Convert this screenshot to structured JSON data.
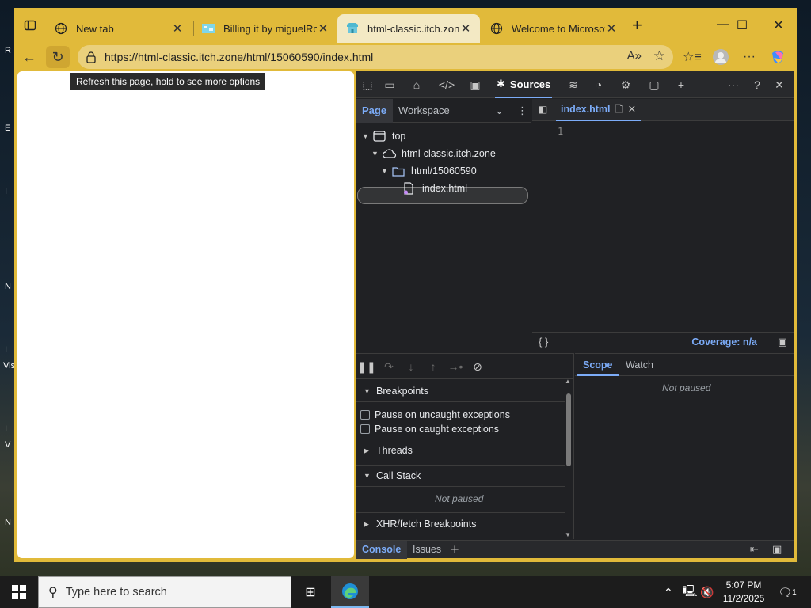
{
  "desktop": {
    "edge_letters": [
      "R",
      "E",
      "I",
      "N",
      "I",
      "Vis",
      "I",
      "V",
      "N"
    ]
  },
  "browser": {
    "tabs": [
      {
        "title": "New tab",
        "icon": "globe-icon",
        "active": false
      },
      {
        "title": "Billing it by miguelRob",
        "icon": "game-icon",
        "active": false
      },
      {
        "title": "html-classic.itch.zone/h",
        "icon": "itch-icon",
        "active": true
      },
      {
        "title": "Welcome to Microsoft",
        "icon": "globe-icon",
        "active": false
      }
    ],
    "url": "https://html-classic.itch.zone/html/15060590/index.html",
    "tooltip": "Refresh this page, hold to see more options"
  },
  "devtools": {
    "active_panel": "Sources",
    "navigator_tabs": [
      "Page",
      "Workspace"
    ],
    "tree": [
      {
        "label": "top",
        "icon": "frame-icon"
      },
      {
        "label": "html-classic.itch.zone",
        "icon": "cloud-icon"
      },
      {
        "label": "html/15060590",
        "icon": "folder-icon"
      },
      {
        "label": "index.html",
        "icon": "file-icon"
      }
    ],
    "editor": {
      "open_file": "index.html",
      "line_numbers": [
        "1"
      ],
      "coverage": "Coverage: n/a",
      "braces": "{ }"
    },
    "debugger": {
      "sections": [
        "Breakpoints",
        "Threads",
        "Call Stack",
        "XHR/fetch Breakpoints"
      ],
      "checkboxes": [
        "Pause on uncaught exceptions",
        "Pause on caught exceptions"
      ],
      "call_stack_status": "Not paused"
    },
    "scope": {
      "tabs": [
        "Scope",
        "Watch"
      ],
      "status": "Not paused"
    },
    "drawer": {
      "tabs": [
        "Console",
        "Issues"
      ]
    }
  },
  "taskbar": {
    "search_placeholder": "Type here to search",
    "time": "5:07 PM",
    "date": "11/2/2025",
    "notifications": "1"
  },
  "colors": {
    "window_frame": "#e1ba3a",
    "devtools_bg": "#202124",
    "accent": "#7cacf8"
  }
}
